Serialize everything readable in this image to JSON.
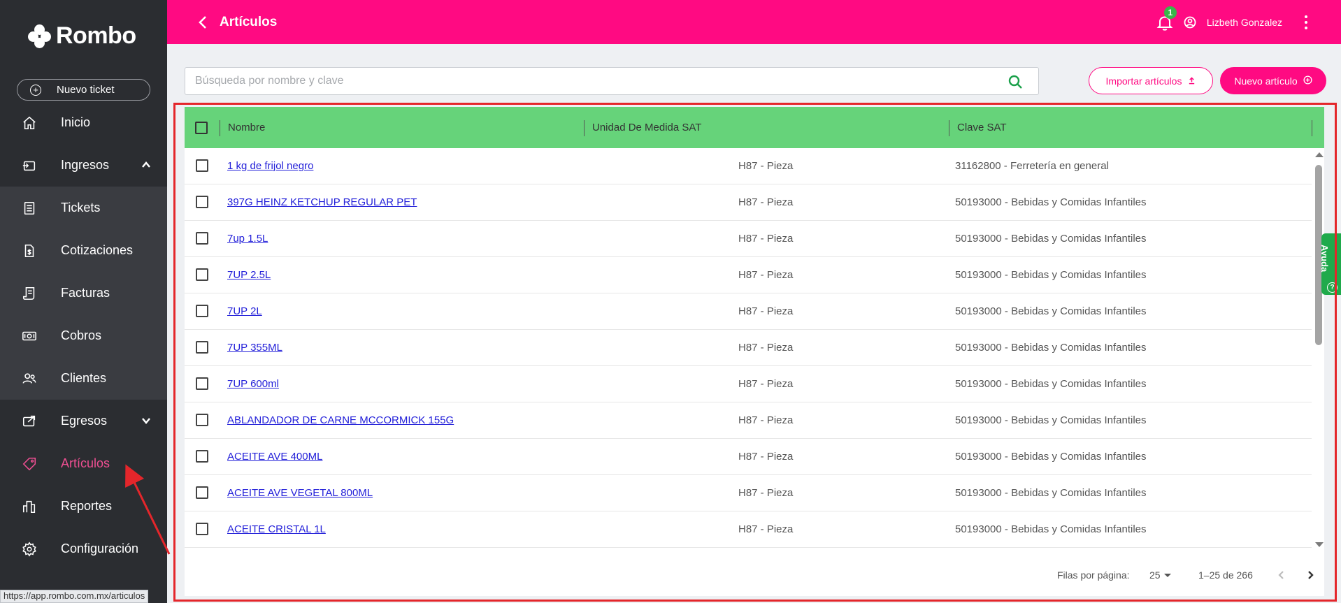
{
  "app": {
    "brand": "Rombo",
    "accent_color": "#ff0a82",
    "header_green": "#66d37a"
  },
  "sidebar": {
    "new_ticket_label": "Nuevo ticket",
    "items": [
      {
        "label": "Inicio",
        "icon": "home-icon"
      },
      {
        "label": "Ingresos",
        "icon": "inbox-in-icon",
        "expanded": true
      },
      {
        "label": "Tickets",
        "icon": "list-icon"
      },
      {
        "label": "Cotizaciones",
        "icon": "document-dollar-icon"
      },
      {
        "label": "Facturas",
        "icon": "receipt-icon"
      },
      {
        "label": "Cobros",
        "icon": "cash-icon"
      },
      {
        "label": "Clientes",
        "icon": "users-icon"
      },
      {
        "label": "Egresos",
        "icon": "outbox-icon",
        "expanded": false
      },
      {
        "label": "Artículos",
        "icon": "tag-icon",
        "active": true
      },
      {
        "label": "Reportes",
        "icon": "bar-chart-icon"
      },
      {
        "label": "Configuración",
        "icon": "gear-icon"
      }
    ]
  },
  "header": {
    "title": "Artículos",
    "notification_count": "1",
    "user_name": "Lizbeth Gonzalez"
  },
  "search": {
    "placeholder": "Búsqueda por nombre y clave",
    "value": ""
  },
  "actions": {
    "import_label": "Importar artículos",
    "new_label": "Nuevo artículo"
  },
  "table": {
    "columns": [
      "Nombre",
      "Unidad De Medida SAT",
      "Clave SAT"
    ],
    "rows": [
      {
        "name": "1 kg de frijol negro",
        "unit": "H87 - Pieza",
        "clave": "31162800 - Ferretería en general"
      },
      {
        "name": "397G HEINZ KETCHUP REGULAR PET",
        "unit": "H87 - Pieza",
        "clave": "50193000 - Bebidas y Comidas Infantiles"
      },
      {
        "name": "7up 1.5L",
        "unit": "H87 - Pieza",
        "clave": "50193000 - Bebidas y Comidas Infantiles"
      },
      {
        "name": "7UP 2.5L",
        "unit": "H87 - Pieza",
        "clave": "50193000 - Bebidas y Comidas Infantiles"
      },
      {
        "name": "7UP 2L",
        "unit": "H87 - Pieza",
        "clave": "50193000 - Bebidas y Comidas Infantiles"
      },
      {
        "name": "7UP 355ML",
        "unit": "H87 - Pieza",
        "clave": "50193000 - Bebidas y Comidas Infantiles"
      },
      {
        "name": "7UP 600ml",
        "unit": "H87 - Pieza",
        "clave": "50193000 - Bebidas y Comidas Infantiles"
      },
      {
        "name": "ABLANDADOR DE CARNE MCCORMICK 155G",
        "unit": "H87 - Pieza",
        "clave": "50193000 - Bebidas y Comidas Infantiles"
      },
      {
        "name": "ACEITE AVE 400ML",
        "unit": "H87 - Pieza",
        "clave": "50193000 - Bebidas y Comidas Infantiles"
      },
      {
        "name": "ACEITE AVE VEGETAL 800ML",
        "unit": "H87 - Pieza",
        "clave": "50193000 - Bebidas y Comidas Infantiles"
      },
      {
        "name": "ACEITE CRISTAL 1L",
        "unit": "H87 - Pieza",
        "clave": "50193000 - Bebidas y Comidas Infantiles"
      }
    ]
  },
  "pagination": {
    "rows_per_page_label": "Filas por página:",
    "rows_per_page": "25",
    "range": "1–25 de 266"
  },
  "help_tab": {
    "label": "Ayuda"
  },
  "status_bar": {
    "url": "https://app.rombo.com.mx/articulos"
  },
  "annotation_color": "#e4262b"
}
